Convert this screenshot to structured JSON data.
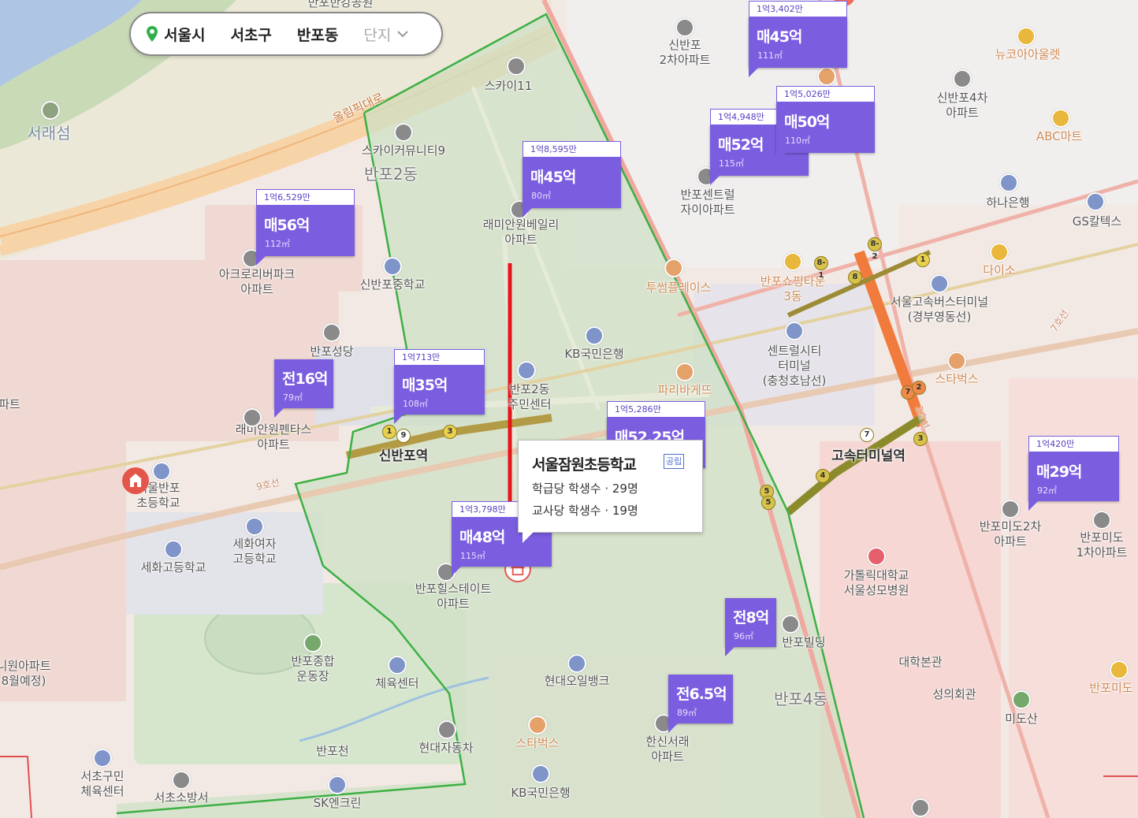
{
  "search": {
    "items": [
      "서울시",
      "서초구",
      "반포동",
      "단지"
    ],
    "icon": "location-pin-icon"
  },
  "markers": [
    {
      "id": "m1",
      "top": "1억3,402만",
      "price": "매45억",
      "area": "111㎡"
    },
    {
      "id": "m2",
      "top": "1억5,026만",
      "price": "매50억",
      "area": "110㎡"
    },
    {
      "id": "m3",
      "top": "1억4,948만",
      "price": "매52억",
      "area": "115㎡"
    },
    {
      "id": "m4",
      "top": "1억8,595만",
      "price": "매45억",
      "area": "80㎡"
    },
    {
      "id": "m5",
      "top": "1억6,529만",
      "price": "매56억",
      "area": "112㎡"
    },
    {
      "id": "m6",
      "top": "",
      "price": "전16억",
      "area": "79㎡"
    },
    {
      "id": "m7",
      "top": "1억713만",
      "price": "매35억",
      "area": "108㎡"
    },
    {
      "id": "m8",
      "top": "1억5,286만",
      "price": "매52.25억",
      "area": ""
    },
    {
      "id": "m9",
      "top": "1억3,798만",
      "price": "매48억",
      "area": "115㎡"
    },
    {
      "id": "m10",
      "top": "1억420만",
      "price": "매29억",
      "area": "92㎡"
    },
    {
      "id": "m11",
      "top": "",
      "price": "전8억",
      "area": "96㎡"
    },
    {
      "id": "m12",
      "top": "",
      "price": "전6.5억",
      "area": "89㎡"
    }
  ],
  "popup": {
    "name": "서울잠원초등학교",
    "badge": "공립",
    "row1": "학급당 학생수 · 29명",
    "row2": "교사당 학생수 · 19명"
  },
  "labels": {
    "sky11": "스카이11",
    "skycommunity": "스카이커뮤니티9",
    "banpo2dong": "반포2동",
    "raemian_bel": "래미안원베일리\n아파트",
    "sinbanpo2": "신반포\n2차아파트",
    "newcore": "뉴코아아울렛",
    "sinbanpo4": "신반포4차\n아파트",
    "abcmart": "ABC마트",
    "banpocentral": "반포센트럴\n자이아파트",
    "hana": "하나은행",
    "gs": "GS칼텍스",
    "acro": "아크로리버파크\n아파트",
    "sinbanpomid": "신반포중학교",
    "banposungdang": "반포성당",
    "kb1": "KB국민은행",
    "tous": "투썸플레이스",
    "banposhop": "반포쇼핑타운\n3동",
    "daiso": "다이소",
    "busterm": "서울고속버스터미널\n(경부영동선)",
    "central": "센트럴시티\n터미널\n(충청호남선)",
    "starbucks1": "스타벅스",
    "paris": "파리바게뜨",
    "community": "반포2동\n주민센터",
    "raemianpent": "래미안원펜타스\n아파트",
    "sinbanpostn": "신반포역",
    "gosok": "고속터미널역",
    "line9": "9호선",
    "line3": "3호선",
    "line7": "7호선",
    "seoulbanpo": "서울반포\n초등학교",
    "sehwagirls": "세화여자\n고등학교",
    "sehwahigh": "세화고등학교",
    "banpohill": "반포힐스테이트\n아파트",
    "banpomido2": "반포미도2차\n아파트",
    "banpomido1": "반포미도\n1차아파트",
    "catholic": "가톨릭대학교\n서울성모병원",
    "univ": "대학본관",
    "seongui": "성의회관",
    "mido": "미도산",
    "banpomido_r": "반포미도",
    "banpobldg": "반포빌딩",
    "banpo4dong": "반포4동",
    "hyundaioil": "현대오일뱅크",
    "sports": "반포종합\n운동장",
    "gym": "체육센터",
    "hanshin": "한신서래\n아파트",
    "starbucks2": "스타벅스",
    "hyundaicar": "현대자동차",
    "banpocheon": "반포천",
    "kb2": "KB국민은행",
    "sk": "SK엔크린",
    "seochosports": "서초구민\n체육센터",
    "fire": "서초소방서",
    "seorae": "서래섬",
    "olympic": "올림픽대로",
    "hangang": "반포한강공원",
    "apt_left": "파트",
    "won_apt": "니원아파트\n8월예정)"
  },
  "colors": {
    "marker": "#7b5ee0",
    "boundary": "#3cb043",
    "arrow": "#e8141b",
    "river": "#aec6e4"
  }
}
